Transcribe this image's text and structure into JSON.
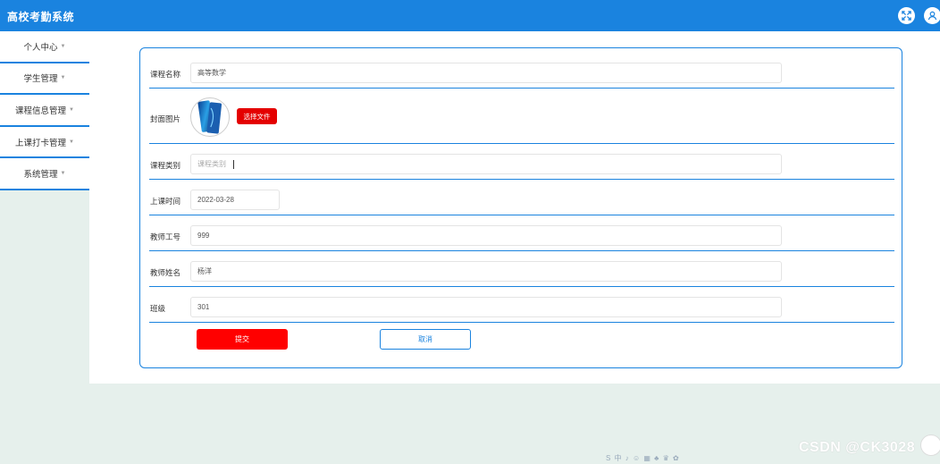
{
  "header": {
    "title": "高校考勤系统",
    "icons": [
      "expand-icon",
      "user-icon"
    ]
  },
  "sidebar": {
    "items": [
      {
        "label": "个人中心"
      },
      {
        "label": "学生管理"
      },
      {
        "label": "课程信息管理"
      },
      {
        "label": "上课打卡管理"
      },
      {
        "label": "系统管理"
      }
    ]
  },
  "form": {
    "course_name": {
      "label": "课程名称",
      "value": "高等数学"
    },
    "cover": {
      "label": "封面图片",
      "button": "选择文件"
    },
    "course_type": {
      "label": "课程类别",
      "placeholder": "课程类别"
    },
    "class_time": {
      "label": "上课时间",
      "value": "2022-03-28"
    },
    "teacher_id": {
      "label": "教师工号",
      "value": "999"
    },
    "teacher_name": {
      "label": "教师姓名",
      "value": "杨洋"
    },
    "class_no": {
      "label": "班级",
      "value": "301"
    },
    "submit": "提交",
    "cancel": "取消"
  },
  "overlay": {
    "watermark": "CSDN @CK3028",
    "toolbar": "S 中 ♪ ☺ ▦ ♣ ♛ ✿"
  },
  "colors": {
    "primary": "#1a83df",
    "danger": "#ff0000"
  }
}
